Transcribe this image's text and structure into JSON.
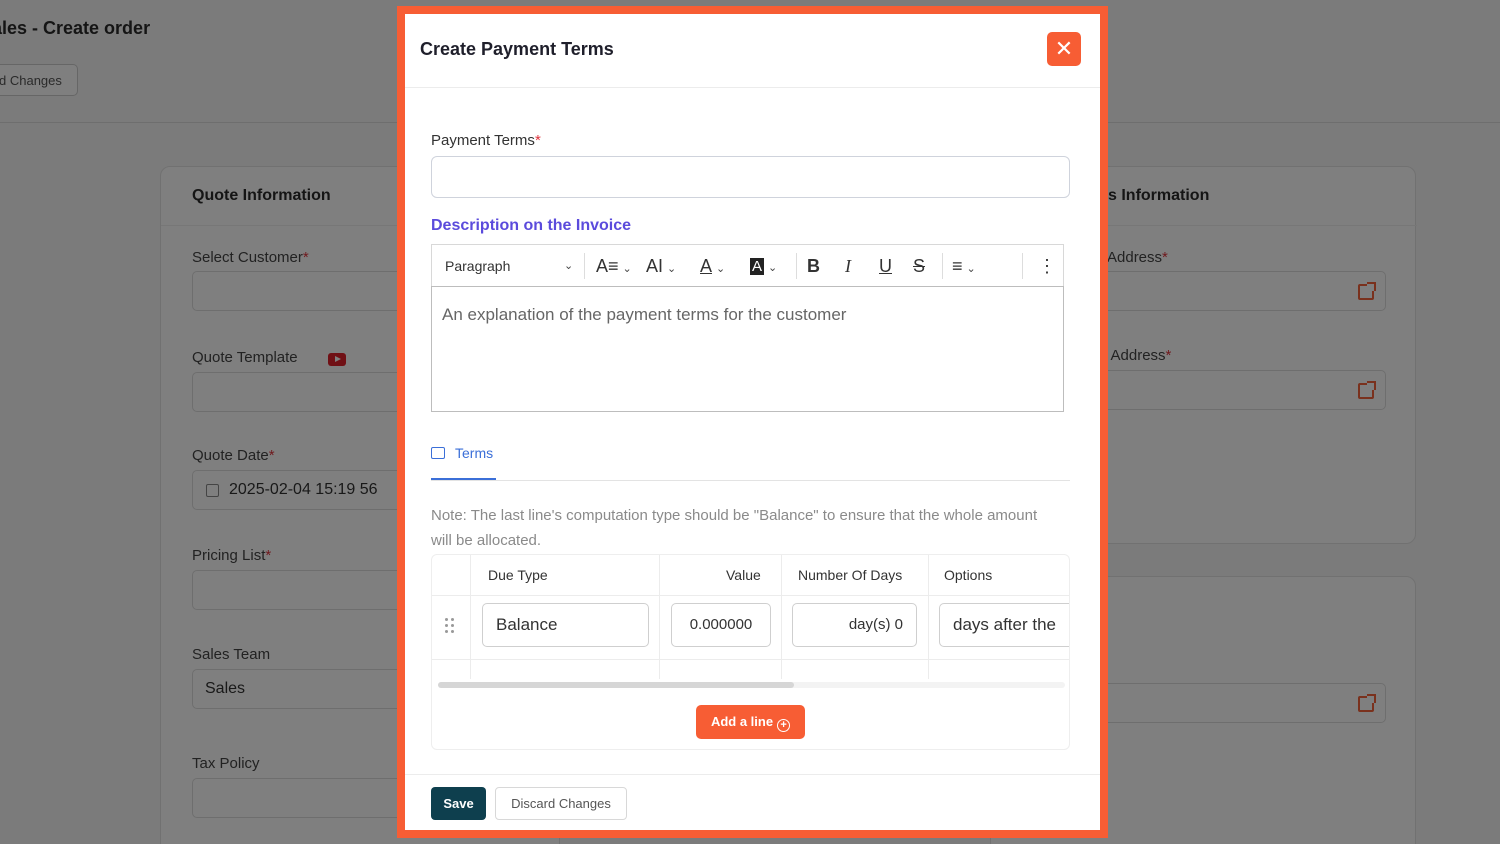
{
  "background": {
    "page_title": "ales - Create order",
    "discard_label": "d Changes",
    "left_card": {
      "title": "Quote Information",
      "fields": [
        {
          "label": "Select Customer",
          "required": true,
          "value": ""
        },
        {
          "label": "Quote Template",
          "required": false,
          "value": ""
        },
        {
          "label": "Quote Date",
          "required": true,
          "value": "2025-02-04 15:19 56"
        },
        {
          "label": "Pricing List",
          "required": true,
          "value": ""
        },
        {
          "label": "Sales Team",
          "required": false,
          "value": "Sales"
        },
        {
          "label": "Tax Policy",
          "required": false,
          "value": ""
        }
      ]
    },
    "right_card": {
      "title": "s Information",
      "fields": [
        {
          "label": "Address",
          "required": true
        },
        {
          "label": "/ Address",
          "required": true
        }
      ]
    }
  },
  "modal": {
    "title": "Create Payment Terms",
    "close_icon": "close-icon",
    "payment_terms": {
      "label": "Payment Terms",
      "required": true,
      "value": "",
      "placeholder": ""
    },
    "description": {
      "label": "Description on the Invoice",
      "toolbar": {
        "block_style": "Paragraph",
        "tools": [
          "font-size",
          "text-size",
          "font-color",
          "highlight-color",
          "bold",
          "italic",
          "underline",
          "strikethrough",
          "align",
          "more"
        ]
      },
      "text": "An explanation of the payment terms for the customer"
    },
    "tabs": [
      {
        "label": "Terms",
        "active": true
      }
    ],
    "note": "Note: The last line's computation type should be \"Balance\" to ensure that the whole amount will be allocated.",
    "table": {
      "columns": [
        "Due Type",
        "Value",
        "Number Of Days",
        "Options"
      ],
      "rows": [
        {
          "due_type": "Balance",
          "value": "0.000000",
          "days": "day(s) 0",
          "options": "days after the"
        }
      ],
      "add_line_label": "Add a line"
    },
    "footer": {
      "save_label": "Save",
      "discard_label": "Discard Changes"
    }
  },
  "colors": {
    "accent": "#f75d34",
    "primary": "#0e3f4e",
    "link": "#3b6fd8",
    "description_label": "#5b4bdc"
  }
}
